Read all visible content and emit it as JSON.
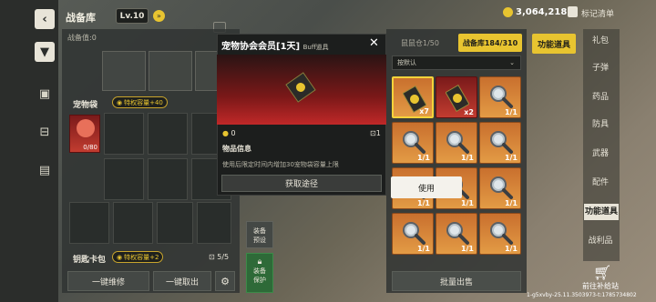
{
  "header": {
    "title": "战备库",
    "level": "Lv.10",
    "currency": "3,064,218",
    "mark_clear": "标记清单"
  },
  "left_panel": {
    "gear_value_label": "战备值:0",
    "pet_bag_label": "宠物袋",
    "pet_privilege": "特权容量+40",
    "pet_count": "0/80",
    "key_bag_label": "钥匙卡包",
    "key_privilege": "特权容量+2",
    "key_count": "5/5",
    "repair_all": "一键维修",
    "take_all": "一键取出"
  },
  "equip_buttons": {
    "preset_line1": "装备",
    "preset_line2": "预设",
    "protect_line1": "装备",
    "protect_line2": "保护"
  },
  "popup": {
    "title": "宠物协会会员[1天]",
    "tag": "Buff道具",
    "value": "0",
    "count": "1",
    "info_label": "物品信息",
    "info_text": "使用后限定时间内增加30宠物袋容量上限",
    "get_path": "获取途径",
    "use": "使用"
  },
  "storage": {
    "tab_safe": "鼠鼠仓1/50",
    "tab_main": "战备库184/310",
    "sort": "按默认",
    "bulk_sell": "批量出售"
  },
  "right_items": [
    {
      "qty": "x7",
      "kind": "card",
      "style": "sel"
    },
    {
      "qty": "x2",
      "kind": "card",
      "style": "red"
    },
    {
      "qty": "1/1",
      "kind": "mag",
      "style": ""
    },
    {
      "qty": "1/1",
      "kind": "mag",
      "style": ""
    },
    {
      "qty": "1/1",
      "kind": "mag",
      "style": ""
    },
    {
      "qty": "1/1",
      "kind": "mag",
      "style": ""
    },
    {
      "qty": "1/1",
      "kind": "mag",
      "style": ""
    },
    {
      "qty": "1/1",
      "kind": "mag",
      "style": ""
    },
    {
      "qty": "1/1",
      "kind": "mag",
      "style": ""
    },
    {
      "qty": "1/1",
      "kind": "mag",
      "style": ""
    },
    {
      "qty": "1/1",
      "kind": "mag",
      "style": ""
    },
    {
      "qty": "1/1",
      "kind": "mag",
      "style": ""
    }
  ],
  "categories": {
    "active": "功能道具",
    "items": [
      "礼包",
      "子弹",
      "药品",
      "防具",
      "武器",
      "配件",
      "功能道具",
      "战利品"
    ]
  },
  "supply": {
    "label": "前往补给站"
  },
  "footer": {
    "build": "1-g5xvby-25.11.3503973-t:1785734802"
  }
}
